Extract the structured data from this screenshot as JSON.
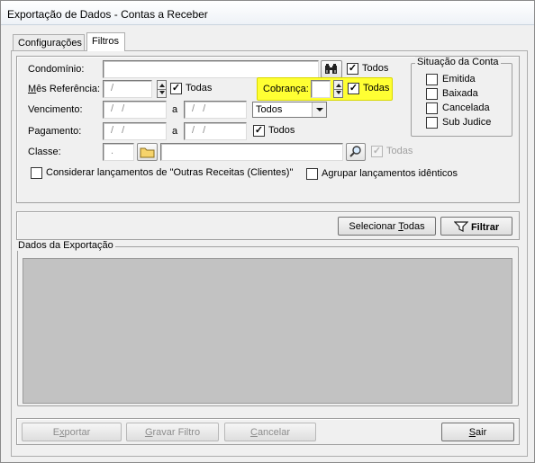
{
  "window": {
    "title": "Exportação de Dados - Contas a Receber"
  },
  "tabs": [
    {
      "label": "Configurações",
      "active": false
    },
    {
      "label": "Filtros",
      "active": true
    }
  ],
  "filters": {
    "condominio": {
      "label": "Condomínio:",
      "value": "",
      "todos_label": "Todos",
      "todos_checked": true
    },
    "mes_referencia": {
      "label": "Mês Referência:",
      "value": "/",
      "todos_label": "Todas",
      "todos_checked": true
    },
    "cobranca": {
      "label": "Cobrança:",
      "value": "",
      "todos_label": "Todas",
      "todos_checked": true
    },
    "vencimento": {
      "label": "Vencimento:",
      "from": "/ /",
      "sep": "a",
      "to": "/ /",
      "select_value": "Todos"
    },
    "pagamento": {
      "label": "Pagamento:",
      "from": "/ /",
      "sep": "a",
      "to": "/ /",
      "todos_label": "Todos",
      "todos_checked": true
    },
    "classe": {
      "label": "Classe:",
      "code": ".",
      "description": "",
      "todas_label": "Todas",
      "todas_checked": true
    },
    "considerar_outras": {
      "label": "Considerar lançamentos de \"Outras Receitas (Clientes)\"",
      "checked": false
    },
    "agrupar_identicos": {
      "label": "Agrupar lançamentos idênticos",
      "checked": false
    }
  },
  "situacao": {
    "title": "Situação da Conta",
    "items": [
      {
        "label": "Emitida",
        "checked": false
      },
      {
        "label": "Baixada",
        "checked": false
      },
      {
        "label": "Cancelada",
        "checked": false
      },
      {
        "label": "Sub Judice",
        "checked": false
      }
    ]
  },
  "actions": {
    "select_all": "Selecionar Todas",
    "filter": "Filtrar"
  },
  "export_group": {
    "title": "Dados da Exportação"
  },
  "footer": {
    "exportar": "Exportar",
    "gravar_filtro": "Gravar Filtro",
    "cancelar": "Cancelar",
    "sair": "Sair"
  },
  "colors": {
    "highlight": "#ffff33",
    "highlight_border": "#d8d800",
    "grid_bg": "#c2c2c2"
  }
}
